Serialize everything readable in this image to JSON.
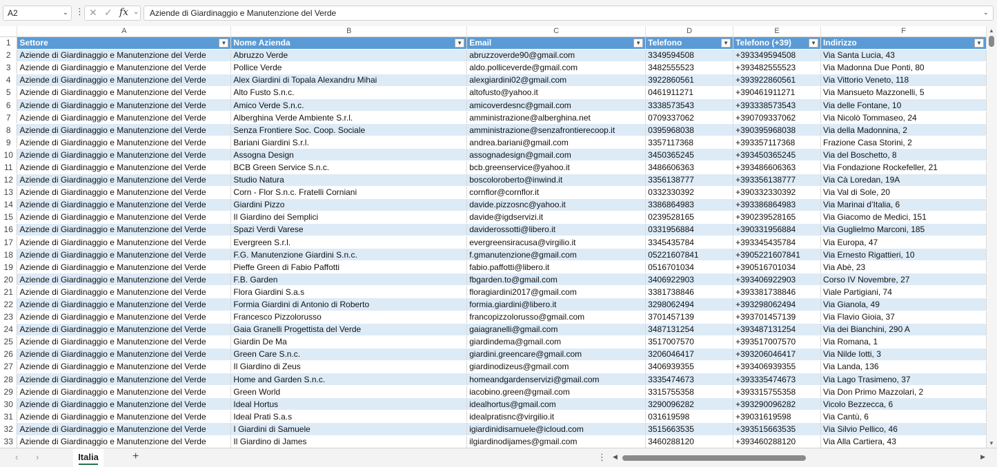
{
  "formula_bar": {
    "name_box": "A2",
    "formula": "Aziende di Giardinaggio e Manutenzione del Verde"
  },
  "columns": [
    "A",
    "B",
    "C",
    "D",
    "E",
    "F"
  ],
  "headers": [
    "Settore",
    "Nome Azienda",
    "Email",
    "Telefono",
    "Telefono (+39)",
    "Indirizzo"
  ],
  "rows": [
    [
      "Aziende di Giardinaggio e Manutenzione del Verde",
      "Abruzzo Verde",
      "abruzzoverde90@gmail.com",
      "3349594508",
      "+393349594508",
      "Via Santa Lucia, 43"
    ],
    [
      "Aziende di Giardinaggio e Manutenzione del Verde",
      "Pollice Verde",
      "aldo.polliceverde@gmail.com",
      "3482555523",
      "+393482555523",
      "Via Madonna Due Ponti, 80"
    ],
    [
      "Aziende di Giardinaggio e Manutenzione del Verde",
      "Alex Giardini di Topala Alexandru Mihai",
      "alexgiardini02@gmail.com",
      "3922860561",
      "+393922860561",
      "Via Vittorio Veneto, 118"
    ],
    [
      "Aziende di Giardinaggio e Manutenzione del Verde",
      "Alto Fusto S.n.c.",
      "altofusto@yahoo.it",
      "0461911271",
      "+390461911271",
      "Via Mansueto Mazzonelli, 5"
    ],
    [
      "Aziende di Giardinaggio e Manutenzione del Verde",
      "Amico Verde S.n.c.",
      "amicoverdesnc@gmail.com",
      "3338573543",
      "+393338573543",
      "Via delle Fontane, 10"
    ],
    [
      "Aziende di Giardinaggio e Manutenzione del Verde",
      "Alberghina Verde Ambiente S.r.l.",
      "amministrazione@alberghina.net",
      "0709337062",
      "+390709337062",
      "Via Nicolò Tommaseo, 24"
    ],
    [
      "Aziende di Giardinaggio e Manutenzione del Verde",
      "Senza Frontiere Soc. Coop. Sociale",
      "amministrazione@senzafrontierecoop.it",
      "0395968038",
      "+390395968038",
      "Via della Madonnina, 2"
    ],
    [
      "Aziende di Giardinaggio e Manutenzione del Verde",
      "Bariani Giardini S.r.l.",
      "andrea.bariani@gmail.com",
      "3357117368",
      "+393357117368",
      "Frazione Casa Storini, 2"
    ],
    [
      "Aziende di Giardinaggio e Manutenzione del Verde",
      "Assogna Design",
      "assognadesign@gmail.com",
      "3450365245",
      "+393450365245",
      "Via del Boschetto, 8"
    ],
    [
      "Aziende di Giardinaggio e Manutenzione del Verde",
      "BCB Green Service S.n.c.",
      "bcb.greenservice@yahoo.it",
      "3486606363",
      "+393486606363",
      "Via Fondazione Rockefeller, 21"
    ],
    [
      "Aziende di Giardinaggio e Manutenzione del Verde",
      "Studio Natura",
      "boscoloroberto@inwind.it",
      "3356138777",
      "+393356138777",
      "Via Cà Loredan, 19A"
    ],
    [
      "Aziende di Giardinaggio e Manutenzione del Verde",
      "Corn - Flor S.n.c. Fratelli Corniani",
      "cornflor@cornflor.it",
      "0332330392",
      "+390332330392",
      "Via Val di Sole, 20"
    ],
    [
      "Aziende di Giardinaggio e Manutenzione del Verde",
      "Giardini Pizzo",
      "davide.pizzosnc@yahoo.it",
      "3386864983",
      "+393386864983",
      "Via Marinai d’Italia, 6"
    ],
    [
      "Aziende di Giardinaggio e Manutenzione del Verde",
      "Il Giardino dei Semplici",
      "davide@igdservizi.it",
      "0239528165",
      "+390239528165",
      "Via Giacomo de Medici, 151"
    ],
    [
      "Aziende di Giardinaggio e Manutenzione del Verde",
      "Spazi Verdi Varese",
      "daviderossotti@libero.it",
      "0331956884",
      "+390331956884",
      "Via Guglielmo Marconi, 185"
    ],
    [
      "Aziende di Giardinaggio e Manutenzione del Verde",
      "Evergreen S.r.l.",
      "evergreensiracusa@virgilio.it",
      "3345435784",
      "+393345435784",
      "Via Europa, 47"
    ],
    [
      "Aziende di Giardinaggio e Manutenzione del Verde",
      "F.G. Manutenzione Giardini S.n.c.",
      "f.gmanutenzione@gmail.com",
      "05221607841",
      "+3905221607841",
      "Via Ernesto Rigattieri, 10"
    ],
    [
      "Aziende di Giardinaggio e Manutenzione del Verde",
      "Pieffe Green di Fabio Paffotti",
      "fabio.paffotti@libero.it",
      "0516701034",
      "+390516701034",
      "Via Abè, 23"
    ],
    [
      "Aziende di Giardinaggio e Manutenzione del Verde",
      "F.B. Garden",
      "fbgarden.to@gmail.com",
      "3406922903",
      "+393406922903",
      "Corso IV Novembre, 27"
    ],
    [
      "Aziende di Giardinaggio e Manutenzione del Verde",
      "Flora Giardini S.a.s",
      "floragiardini2017@gmail.com",
      "3381738846",
      "+393381738846",
      "Viale Partigiani, 74"
    ],
    [
      "Aziende di Giardinaggio e Manutenzione del Verde",
      "Formia Giardini di Antonio di Roberto",
      "formia.giardini@libero.it",
      "3298062494",
      "+393298062494",
      "Via Gianola, 49"
    ],
    [
      "Aziende di Giardinaggio e Manutenzione del Verde",
      "Francesco Pizzolorusso",
      "francopizzolorusso@gmail.com",
      "3701457139",
      "+393701457139",
      "Via Flavio Gioia, 37"
    ],
    [
      "Aziende di Giardinaggio e Manutenzione del Verde",
      "Gaia Granelli Progettista del Verde",
      "gaiagranelli@gmail.com",
      "3487131254",
      "+393487131254",
      "Via dei Bianchini, 290 A"
    ],
    [
      "Aziende di Giardinaggio e Manutenzione del Verde",
      "Giardin De Ma",
      "giardindema@gmail.com",
      "3517007570",
      "+393517007570",
      "Via Romana, 1"
    ],
    [
      "Aziende di Giardinaggio e Manutenzione del Verde",
      "Green Care S.n.c.",
      "giardini.greencare@gmail.com",
      "3206046417",
      "+393206046417",
      "Via Nilde Iotti, 3"
    ],
    [
      "Aziende di Giardinaggio e Manutenzione del Verde",
      "Il Giardino di Zeus",
      "giardinodizeus@gmail.com",
      "3406939355",
      "+393406939355",
      "Via Landa, 136"
    ],
    [
      "Aziende di Giardinaggio e Manutenzione del Verde",
      "Home and Garden S.n.c.",
      "homeandgardenservizi@gmail.com",
      "3335474673",
      "+393335474673",
      "Via Lago Trasimeno, 37"
    ],
    [
      "Aziende di Giardinaggio e Manutenzione del Verde",
      "Green World",
      "iacobino.green@gmail.com",
      "3315755358",
      "+393315755358",
      "Via Don Primo Mazzolari, 2"
    ],
    [
      "Aziende di Giardinaggio e Manutenzione del Verde",
      "Ideal Hortus",
      "idealhortus@gmail.com",
      "3290096282",
      "+393290096282",
      "Vicolo Bezzecca, 6"
    ],
    [
      "Aziende di Giardinaggio e Manutenzione del Verde",
      "Ideal Prati S.a.s",
      "idealpratisnc@virgilio.it",
      "031619598",
      "+39031619598",
      "Via Cantù, 6"
    ],
    [
      "Aziende di Giardinaggio e Manutenzione del Verde",
      "I Giardini di Samuele",
      "igiardinidisamuele@icloud.com",
      "3515663535",
      "+393515663535",
      "Via Silvio Pellico, 46"
    ],
    [
      "Aziende di Giardinaggio e Manutenzione del Verde",
      "Il Giardino di James",
      "ilgiardinodijames@gmail.com",
      "3460288120",
      "+393460288120",
      "Via Alla Cartiera, 43"
    ]
  ],
  "sheet_tabs": [
    "Italia"
  ],
  "icons": {
    "formula_cancel": "close-icon",
    "formula_confirm": "check-icon",
    "function": "fx-icon"
  },
  "colors": {
    "header_fill": "#5b9bd5",
    "band_fill": "#ddebf7",
    "accent": "#217346"
  }
}
